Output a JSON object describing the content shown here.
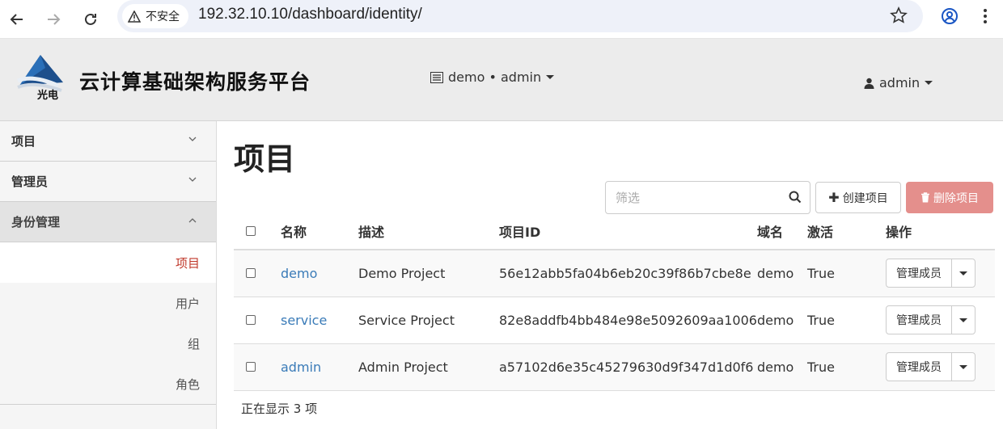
{
  "browser": {
    "security_label": "不安全",
    "url": "192.32.10.10/dashboard/identity/"
  },
  "header": {
    "logo_text": "光电",
    "platform_title": "云计算基础架构服务平台",
    "context_label": "demo • admin",
    "user_label": "admin"
  },
  "sidebar": {
    "sections": [
      {
        "label": "项目"
      },
      {
        "label": "管理员"
      },
      {
        "label": "身份管理"
      }
    ],
    "items": [
      {
        "label": "项目"
      },
      {
        "label": "用户"
      },
      {
        "label": "组"
      },
      {
        "label": "角色"
      }
    ]
  },
  "main": {
    "title": "项目",
    "filter_placeholder": "筛选",
    "create_label": "创建项目",
    "delete_label": "删除项目",
    "columns": [
      "名称",
      "描述",
      "项目ID",
      "域名",
      "激活",
      "操作"
    ],
    "rows": [
      {
        "name": "demo",
        "description": "Demo Project",
        "id": "56e12abb5fa04b6eb20c39f86b7cbe8e",
        "domain": "demo",
        "enabled": "True",
        "action": "管理成员"
      },
      {
        "name": "service",
        "description": "Service Project",
        "id": "82e8addfb4bb484e98e5092609aa1006",
        "domain": "demo",
        "enabled": "True",
        "action": "管理成员"
      },
      {
        "name": "admin",
        "description": "Admin Project",
        "id": "a57102d6e35c45279630d9f347d1d0f6",
        "domain": "demo",
        "enabled": "True",
        "action": "管理成员"
      }
    ],
    "count_text": "正在显示 3 项"
  }
}
